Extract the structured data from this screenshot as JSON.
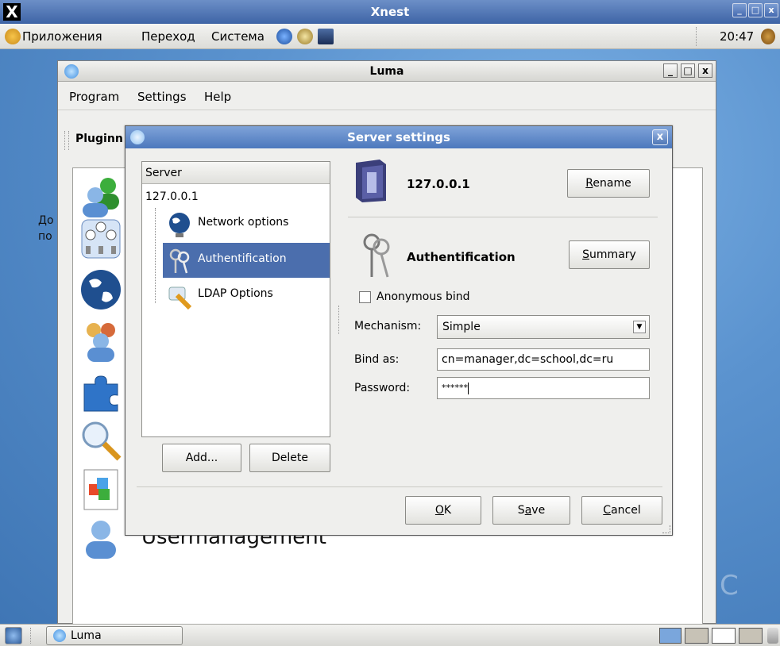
{
  "xnest": {
    "title": "Xnest"
  },
  "top_panel": {
    "menus": [
      "Приложения",
      "Переход",
      "Система"
    ],
    "clock": "20:47"
  },
  "desktop": {
    "label_line1": "До",
    "label_line2": "по",
    "right_letter": "C"
  },
  "luma": {
    "title": "Luma",
    "menus": [
      "Program",
      "Settings",
      "Help"
    ],
    "toolbar_label": "Pluginn",
    "usermanagement_label": "Usermanagement",
    "plugin_icons": [
      "users-icon",
      "network-icon",
      "globe-icon",
      "group-icon",
      "puzzle-icon",
      "search-icon",
      "template-icon",
      "user-icon"
    ]
  },
  "dialog": {
    "title": "Server settings",
    "tree": {
      "header": "Server",
      "root": "127.0.0.1",
      "nodes": [
        {
          "label": "Network options",
          "icon": "network-globe-icon",
          "selected": false
        },
        {
          "label": "Authentification",
          "icon": "keys-icon",
          "selected": true
        },
        {
          "label": "LDAP Options",
          "icon": "wrench-icon",
          "selected": false
        }
      ]
    },
    "add_button": "Add...",
    "delete_button": "Delete",
    "server_name": "127.0.0.1",
    "rename_button": "Rename",
    "auth_title": "Authentification",
    "summary_button": "Summary",
    "anonymous_bind_label": "Anonymous bind",
    "anonymous_bind_checked": false,
    "mechanism_label": "Mechanism:",
    "mechanism_value": "Simple",
    "bind_as_label": "Bind as:",
    "bind_as_value": "cn=manager,dc=school,dc=ru",
    "password_label": "Password:",
    "password_value": "******",
    "ok_button": "OK",
    "save_button": "Save",
    "cancel_button": "Cancel"
  },
  "taskbar": {
    "luma_task": "Luma"
  },
  "colors": {
    "selection": "#4b6ead",
    "dialog_title": "#5a83c4",
    "desktop": "#5b93cf"
  }
}
